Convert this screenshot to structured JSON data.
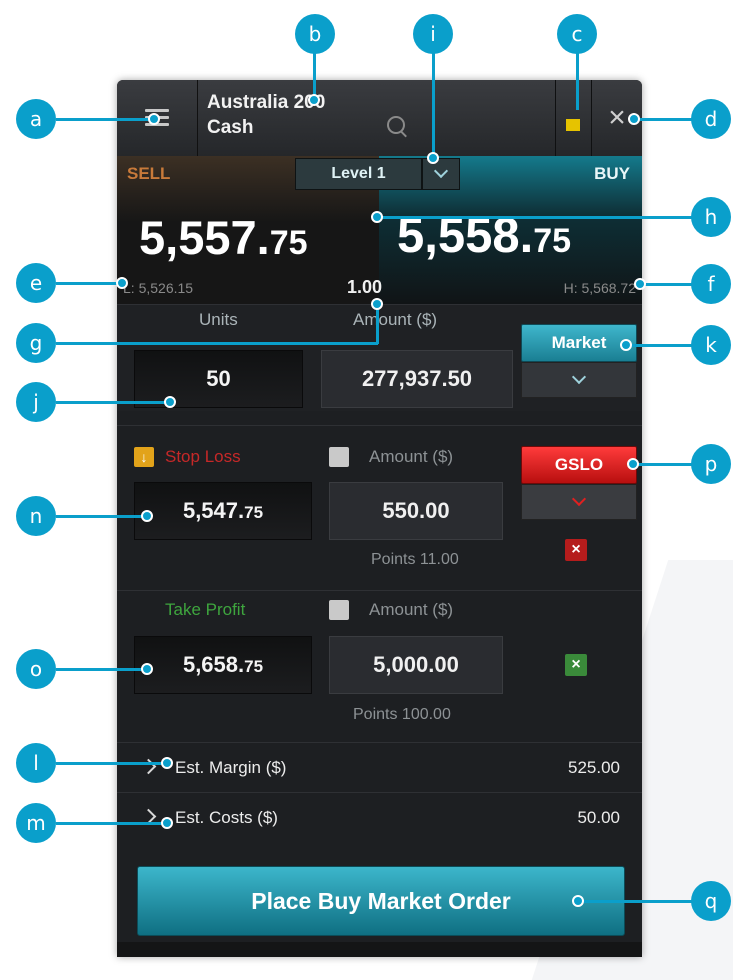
{
  "window": {
    "title_line1": "Australia 200",
    "title_line2": "Cash",
    "close_glyph": "×"
  },
  "prices": {
    "sell_label": "SELL",
    "buy_label": "BUY",
    "level_label": "Level 1",
    "sell_int": "5,557.",
    "sell_dec": "75",
    "buy_int": "5,558.",
    "buy_dec": "75",
    "low": "L: 5,526.15",
    "spread": "1.00",
    "high": "H: 5,568.72"
  },
  "quantity": {
    "units_label": "Units",
    "amount_label": "Amount ($)",
    "units_value": "50",
    "amount_value": "277,937.50",
    "order_type": "Market"
  },
  "stop_loss": {
    "label": "Stop Loss",
    "amount_label": "Amount ($)",
    "price_int": "5,547.",
    "price_dec": "75",
    "amount_value": "550.00",
    "points": "Points 11.00",
    "guarantee_label": "GSLO"
  },
  "take_profit": {
    "label": "Take Profit",
    "amount_label": "Amount ($)",
    "price_int": "5,658.",
    "price_dec": "75",
    "amount_value": "5,000.00",
    "points": "Points 100.00"
  },
  "estimates": {
    "margin_label": "Est. Margin ($)",
    "margin_value": "525.00",
    "costs_label": "Est. Costs ($)",
    "costs_value": "50.00"
  },
  "actions": {
    "place_order": "Place Buy Market Order"
  },
  "callouts": [
    "a",
    "b",
    "c",
    "d",
    "e",
    "f",
    "g",
    "h",
    "i",
    "j",
    "k",
    "l",
    "m",
    "n",
    "o",
    "p",
    "q"
  ],
  "colors": {
    "callout": "#0a9fcb",
    "buy_accent": "#1a8fa5",
    "sell_accent": "#c87a3a",
    "stop_loss": "#c62828",
    "take_profit": "#3ea53e",
    "gslo": "#e01e1e"
  },
  "icons": {
    "menu": "menu-icon",
    "search": "search-icon",
    "minimize": "minimize-icon",
    "close": "close-icon",
    "chevron": "chevron-down-icon",
    "stop_arrow": "arrow-down-icon",
    "toggle": "up-down-toggle-icon",
    "remove": "x-icon",
    "expand": "chevron-right-icon"
  }
}
